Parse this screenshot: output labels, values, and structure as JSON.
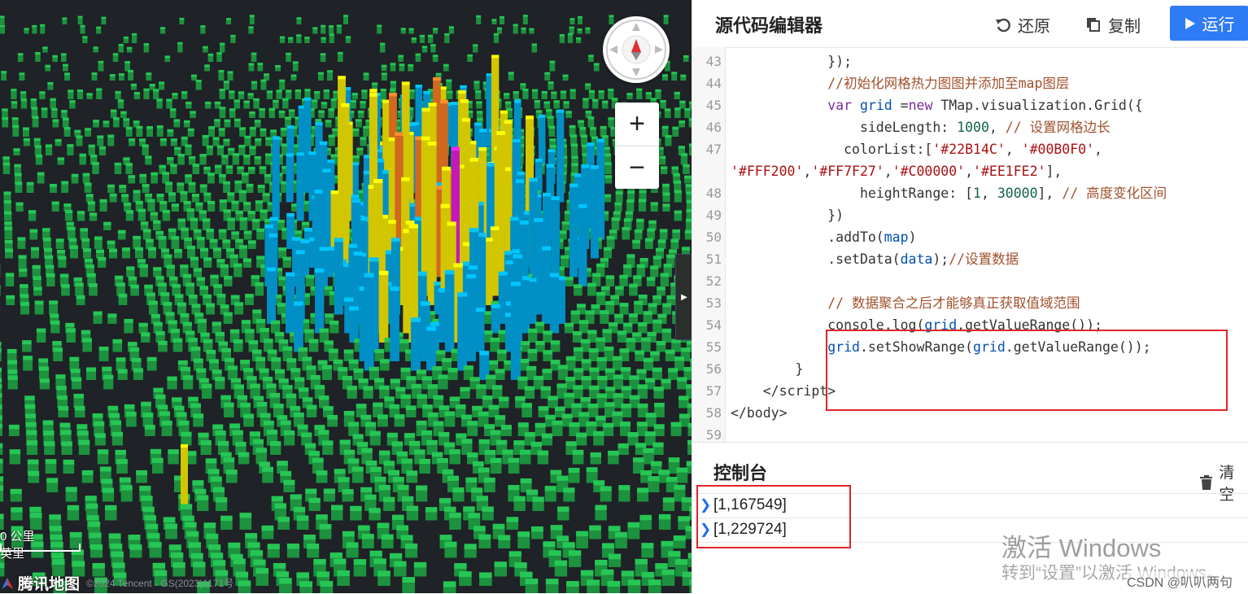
{
  "map": {
    "brand": "腾讯地图",
    "copyright": "©2024 Tencent - GS(2023)1171号",
    "scale_metric": "0 公里",
    "scale_imperial": "英里"
  },
  "editor": {
    "title": "源代码编辑器",
    "restore_label": "还原",
    "copy_label": "复制",
    "run_label": "运行",
    "code_lines": [
      {
        "n": "43",
        "html": "            });"
      },
      {
        "n": "44",
        "html": "            <span class='c-com'>//初始化网格热力图图并添加至map图层</span>"
      },
      {
        "n": "45",
        "html": "            <span class='c-kw'>var</span> <span class='c-var'>grid</span> =<span class='c-kw'>new</span> TMap.visualization.Grid({"
      },
      {
        "n": "46",
        "html": "                sideLength: <span class='c-num'>1000</span>, <span class='c-com'>// 设置网格边长</span>"
      },
      {
        "n": "47",
        "html": "              colorList:[<span class='c-str'>'#22B14C'</span>, <span class='c-str'>'#00B0F0'</span>,"
      },
      {
        "n": "",
        "html": "<span class='c-str'>'#FFF200'</span>,<span class='c-str'>'#FF7F27'</span>,<span class='c-str'>'#C00000'</span>,<span class='c-str'>'#EE1FE2'</span>],"
      },
      {
        "n": "48",
        "html": "                heightRange: [<span class='c-num'>1</span>, <span class='c-num'>30000</span>], <span class='c-com'>// 高度变化区间</span>"
      },
      {
        "n": "49",
        "html": "            })"
      },
      {
        "n": "50",
        "html": "            .addTo(<span class='c-var'>map</span>)"
      },
      {
        "n": "51",
        "html": "            .setData(<span class='c-var'>data</span>);<span class='c-com'>//设置数据</span>"
      },
      {
        "n": "52",
        "html": ""
      },
      {
        "n": "53",
        "html": "            <span class='c-com'>// 数据聚合之后才能够真正获取值域范围</span>"
      },
      {
        "n": "54",
        "html": "            console.log(<span class='c-var'>grid</span>.getValueRange());"
      },
      {
        "n": "55",
        "html": "            <span class='c-var'>grid</span>.setShowRange(<span class='c-var'>grid</span>.getValueRange());"
      },
      {
        "n": "56",
        "html": "        }"
      },
      {
        "n": "57",
        "html": "    &lt;/script&gt;"
      },
      {
        "n": "58",
        "html": "&lt;/body&gt;"
      },
      {
        "n": "59",
        "html": ""
      }
    ]
  },
  "console": {
    "title": "控制台",
    "clear_label": "清空",
    "entries": [
      "[1,167549]",
      "[1,229724]"
    ]
  },
  "overlay": {
    "activate_title": "激活 Windows",
    "activate_sub": "转到“设置”以激活 Windows。",
    "csdn": "CSDN @叭叭两句"
  },
  "colors": {
    "green": "#22B14C",
    "blue": "#00B0F0",
    "yellow": "#FFF200",
    "orange": "#FF7F27",
    "red": "#C00000",
    "magenta": "#EE1FE2",
    "run_button": "#2f7bf5"
  }
}
